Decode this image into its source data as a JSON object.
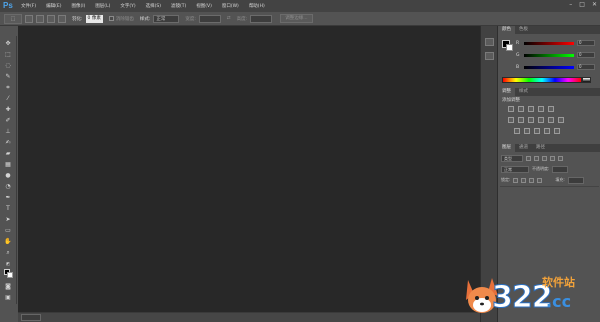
{
  "app": {
    "logo": "Ps"
  },
  "menu": {
    "items": [
      "文件(F)",
      "编辑(E)",
      "图像(I)",
      "图层(L)",
      "文字(Y)",
      "选择(S)",
      "滤镜(T)",
      "视图(V)",
      "窗口(W)",
      "帮助(H)"
    ]
  },
  "window_controls": {
    "minimize": "–",
    "maximize": "□",
    "close": "✕"
  },
  "options": {
    "feather_label": "羽化:",
    "feather_value": "0 像素",
    "antialias_label": "消除锯齿",
    "style_label": "样式:",
    "style_value": "正常",
    "width_label": "宽度:",
    "height_label": "高度:",
    "refine_button": "调整边缘..."
  },
  "workspace": {
    "value": "基本功能"
  },
  "colors": {
    "canvas": "#282828",
    "chrome": "#535353",
    "accent": "#4ea4ea"
  },
  "color_panel": {
    "tabs": [
      "颜色",
      "色板"
    ],
    "sliders": [
      {
        "letter": "R",
        "value": "0",
        "gradient": "linear-gradient(to right,#000,#ff0000)"
      },
      {
        "letter": "G",
        "value": "0",
        "gradient": "linear-gradient(to right,#000,#00ff00)"
      },
      {
        "letter": "B",
        "value": "0",
        "gradient": "linear-gradient(to right,#000,#0000ff)"
      }
    ]
  },
  "adjust_panel": {
    "tabs": [
      "调整",
      "样式"
    ],
    "title": "添加调整"
  },
  "layers_panel": {
    "tabs": [
      "图层",
      "通道",
      "路径"
    ],
    "kind_label": "类型",
    "blend_mode": "正常",
    "opacity_label": "不透明度:",
    "lock_label": "锁定:",
    "fill_label": "填充:"
  },
  "statusbar": {
    "zoom": ""
  },
  "watermark": {
    "number": "322",
    "domain": ".cc",
    "site_name": "软件站"
  }
}
